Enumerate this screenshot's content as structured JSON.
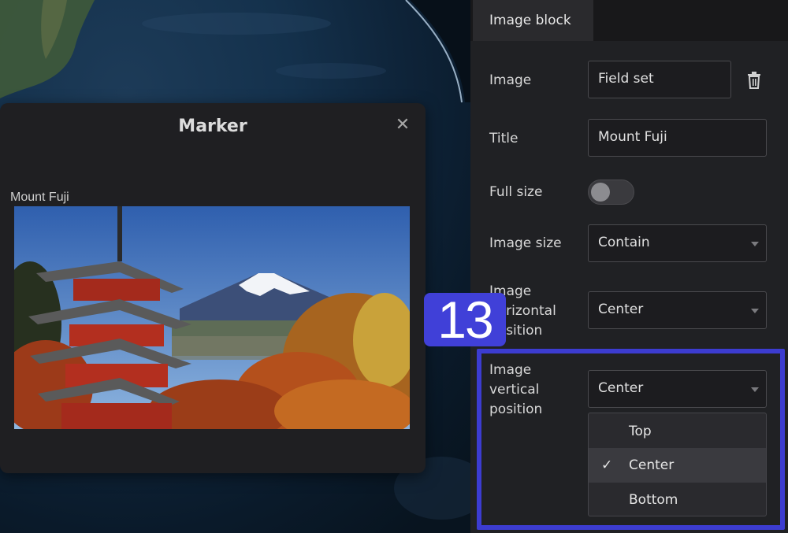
{
  "marker_popup": {
    "title": "Marker",
    "close_icon": "close-icon",
    "image_caption": "Mount Fuji"
  },
  "panel": {
    "tab_label": "Image block",
    "fields": {
      "image": {
        "label": "Image",
        "value": "Field set",
        "delete_icon": "trash-icon"
      },
      "title": {
        "label": "Title",
        "value": "Mount Fuji"
      },
      "full_size": {
        "label": "Full size",
        "enabled": false
      },
      "image_size": {
        "label": "Image size",
        "value": "Contain"
      },
      "horizontal_position": {
        "label_lines": [
          "Image",
          "horizontal",
          "position"
        ],
        "value": "Center"
      },
      "vertical_position": {
        "label_lines": [
          "Image",
          "vertical",
          "position"
        ],
        "value": "Center"
      }
    },
    "vertical_position_options": [
      "Top",
      "Center",
      "Bottom"
    ],
    "selected_option": "Center",
    "check_glyph": "✓"
  },
  "callout": {
    "step_number": "13",
    "color": "#3c3cd0"
  }
}
